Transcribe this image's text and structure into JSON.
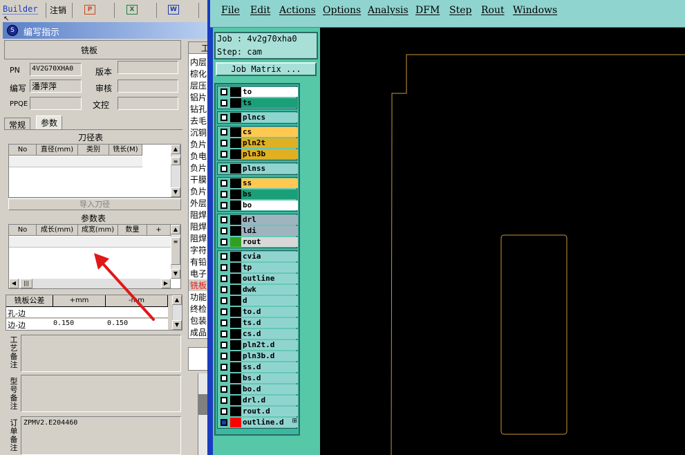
{
  "topbar": {
    "builder_label": "Builder",
    "logout_label": "注销",
    "app_icons": [
      {
        "name": "powerpoint-icon",
        "glyph": "P",
        "color": "#c84a1c"
      },
      {
        "name": "excel-icon",
        "glyph": "X",
        "color": "#1c7a3a"
      },
      {
        "name": "word-icon",
        "glyph": "W",
        "color": "#1c3aa8"
      }
    ]
  },
  "window": {
    "title": "编写指示"
  },
  "form": {
    "section_title": "铣板",
    "pn_label": "PN",
    "pn_value": "4V2G70XHA0",
    "version_label": "版本",
    "version_value": "",
    "author_label": "编写",
    "author_value": "潘萍萍",
    "review_label": "审核",
    "review_value": "",
    "ppqe_label": "PPQE",
    "ppqe_value": "",
    "doc_control_label": "文控",
    "doc_control_value": "",
    "tabs": [
      {
        "label": "常规",
        "active": false
      },
      {
        "label": "参数",
        "active": true
      }
    ],
    "tool_table": {
      "title": "刀径表",
      "columns": [
        "No",
        "直径(mm)",
        "类别",
        "铣长(M)"
      ],
      "import_button": "导入刀径"
    },
    "param_table": {
      "title": "参数表",
      "columns": [
        "No",
        "成长(mm)",
        "成宽(mm)",
        "数量",
        "+"
      ]
    },
    "tolerance_table": {
      "columns": [
        "铣板公差",
        "+mm",
        "-mm"
      ],
      "rows": [
        {
          "name": "孔-边",
          "plus": "",
          "minus": ""
        },
        {
          "name": "边-边",
          "plus": "0.150",
          "minus": "0.150"
        }
      ]
    },
    "notes": [
      {
        "label": "工艺备注",
        "value": ""
      },
      {
        "label": "型号备注",
        "value": ""
      },
      {
        "label": "订单备注",
        "value": "ZPMV2.E204460"
      }
    ]
  },
  "process_list": {
    "header": "工",
    "items": [
      {
        "label": "内层",
        "selected": false
      },
      {
        "label": "棕化",
        "selected": false
      },
      {
        "label": "层压",
        "selected": false
      },
      {
        "label": "铝片",
        "selected": false
      },
      {
        "label": "钻孔",
        "selected": false
      },
      {
        "label": "去毛",
        "selected": false
      },
      {
        "label": "沉铜",
        "selected": false
      },
      {
        "label": "负片",
        "selected": false
      },
      {
        "label": "负电",
        "selected": false
      },
      {
        "label": "负片",
        "selected": false
      },
      {
        "label": "干膜",
        "selected": false
      },
      {
        "label": "负片",
        "selected": false
      },
      {
        "label": "外层",
        "selected": false
      },
      {
        "label": "阻焊",
        "selected": false
      },
      {
        "label": "阻焊",
        "selected": false
      },
      {
        "label": "阻焊",
        "selected": false
      },
      {
        "label": "字符",
        "selected": false
      },
      {
        "label": "有铅",
        "selected": false
      },
      {
        "label": "电子",
        "selected": false
      },
      {
        "label": "铣板",
        "selected": true
      },
      {
        "label": "功能",
        "selected": false
      },
      {
        "label": "终检",
        "selected": false
      },
      {
        "label": "包装",
        "selected": false
      },
      {
        "label": "成品",
        "selected": false
      }
    ]
  },
  "menubar": {
    "items": [
      "File",
      "Edit",
      "Actions",
      "Options",
      "Analysis",
      "DFM",
      "Step",
      "Rout",
      "Windows"
    ]
  },
  "job": {
    "job_label": "Job : 4v2g70xha0",
    "step_label": "Step: cam",
    "matrix_button": "Job Matrix ..."
  },
  "layer_groups": [
    [
      {
        "name": "to",
        "color": "#ffffff",
        "marker": "#000000"
      },
      {
        "name": "ts",
        "color": "#1aa078",
        "marker": "#000000"
      }
    ],
    [
      {
        "name": "plncs",
        "color": "#90d4d0",
        "marker": "#000000"
      }
    ],
    [
      {
        "name": "cs",
        "color": "#ffc850",
        "marker": "#000000"
      },
      {
        "name": "pln2t",
        "color": "#e0b020",
        "marker": "#000000"
      },
      {
        "name": "pln3b",
        "color": "#e0b020",
        "marker": "#000000"
      }
    ],
    [
      {
        "name": "plnss",
        "color": "#90d4d0",
        "marker": "#000000"
      }
    ],
    [
      {
        "name": "ss",
        "color": "#ffc850",
        "marker": "#000000"
      },
      {
        "name": "bs",
        "color": "#1aa078",
        "marker": "#000000"
      },
      {
        "name": "bo",
        "color": "#ffffff",
        "marker": "#000000"
      }
    ],
    [
      {
        "name": "drl",
        "color": "#a0b4c0",
        "marker": "#000000"
      },
      {
        "name": "ldi",
        "color": "#a0b4c0",
        "marker": "#000000"
      },
      {
        "name": "rout",
        "color": "#d8d8d8",
        "marker": "#30a020"
      }
    ],
    [
      {
        "name": "cvia",
        "color": "#90d4d0",
        "marker": "#000000"
      },
      {
        "name": "tp",
        "color": "#90d4d0",
        "marker": "#000000"
      },
      {
        "name": "outline",
        "color": "#90d4d0",
        "marker": "#000000"
      },
      {
        "name": "dwk",
        "color": "#90d4d0",
        "marker": "#000000"
      },
      {
        "name": "d",
        "color": "#90d4d0",
        "marker": "#000000"
      },
      {
        "name": "to.d",
        "color": "#90d4d0",
        "marker": "#000000"
      },
      {
        "name": "ts.d",
        "color": "#90d4d0",
        "marker": "#000000"
      },
      {
        "name": "cs.d",
        "color": "#90d4d0",
        "marker": "#000000"
      },
      {
        "name": "pln2t.d",
        "color": "#90d4d0",
        "marker": "#000000"
      },
      {
        "name": "pln3b.d",
        "color": "#90d4d0",
        "marker": "#000000"
      },
      {
        "name": "ss.d",
        "color": "#90d4d0",
        "marker": "#000000"
      },
      {
        "name": "bs.d",
        "color": "#90d4d0",
        "marker": "#000000"
      },
      {
        "name": "bo.d",
        "color": "#90d4d0",
        "marker": "#000000"
      },
      {
        "name": "drl.d",
        "color": "#90d4d0",
        "marker": "#000000"
      },
      {
        "name": "rout.d",
        "color": "#90d4d0",
        "marker": "#000000"
      },
      {
        "name": "outline.d",
        "color": "#90d4d0",
        "marker": "#ff0000",
        "checked": true
      }
    ]
  ],
  "colors": {
    "accent_arrow": "#e01818",
    "outline": "#c8963c",
    "canvas_bg": "#000000"
  }
}
